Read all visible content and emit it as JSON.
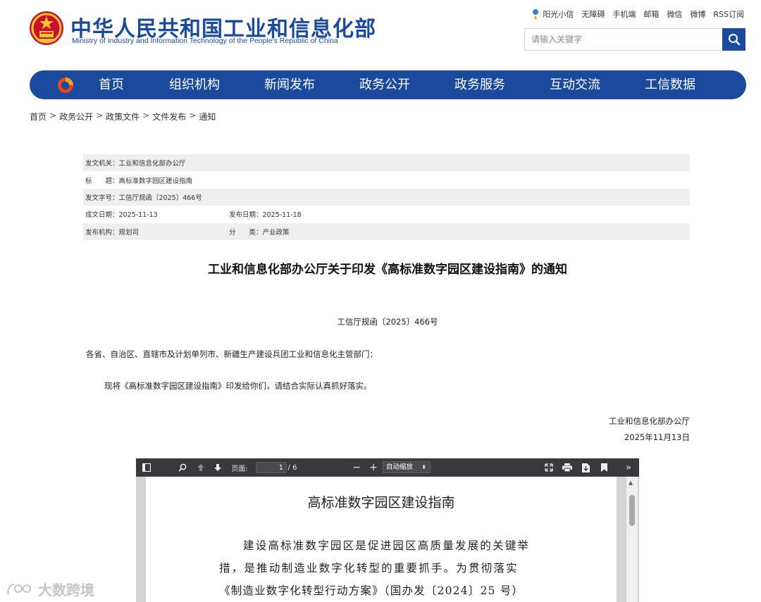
{
  "header": {
    "title": "中华人民共和国工业和信息化部",
    "subtitle": "Ministry of Industry and Information Technology of the People's Republic of China",
    "top_links": [
      "阳光小信",
      "无障碍",
      "手机端",
      "邮箱",
      "微信",
      "微博",
      "RSS订阅"
    ],
    "search_placeholder": "请输入关键字"
  },
  "nav": {
    "items": [
      "首页",
      "组织机构",
      "新闻发布",
      "政务公开",
      "政务服务",
      "互动交流",
      "工信数据"
    ],
    "bg_color": "#1b4a9c"
  },
  "breadcrumb": [
    "首页",
    "政务公开",
    "政策文件",
    "文件发布",
    "通知"
  ],
  "meta": {
    "issuer_label": "发文机关：",
    "issuer_value": "工业和信息化部办公厅",
    "title_label": "标　　题：",
    "title_value": "高标准数字园区建设指南",
    "docno_label": "发文字号：",
    "docno_value": "工信厅规函〔2025〕466号",
    "formed_label": "成文日期：",
    "formed_value": "2025-11-13",
    "published_label": "发布日期：",
    "published_value": "2025-11-18",
    "org_label": "发布机构：",
    "org_value": "规划司",
    "category_label": "分　　类：",
    "category_value": "产业政策"
  },
  "article": {
    "title": "工业和信息化部办公厅关于印发《高标准数字园区建设指南》的通知",
    "doc_number": "工信厅规函〔2025〕466号",
    "addressee": "各省、自治区、直辖市及计划单列市、新疆生产建设兵团工业和信息化主管部门：",
    "body": "现将《高标准数字园区建设指南》印发给你们，请结合实际认真抓好落实。",
    "sign_org": "工业和信息化部办公厅",
    "sign_date": "2025年11月13日"
  },
  "pdf_viewer": {
    "page_label": "页面:",
    "page_current": "1",
    "page_total": "/ 6",
    "zoom_label": "自动缩放",
    "doc_title": "高标准数字园区建设指南",
    "lines": [
      "建设高标准数字园区是促进园区高质量发展的关键举",
      "措，是推动制造业数字化转型的重要抓手。为贯彻落实",
      "《制造业数字化转型行动方案》（国办发〔2024〕25 号）"
    ]
  },
  "watermark": {
    "text": "大数跨境"
  }
}
